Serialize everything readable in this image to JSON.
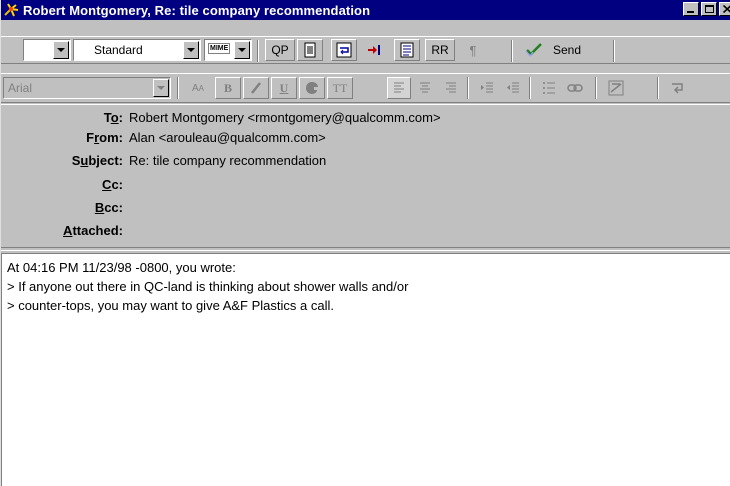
{
  "window": {
    "title": "Robert Montgomery, Re: tile company recommendation",
    "icon": "eudora-message-icon"
  },
  "toolbar1": {
    "priority_value": "",
    "format_value": "Standard",
    "mime_label": "MIME",
    "qp_label": "QP",
    "rr_label": "RR",
    "send_label": "Send",
    "icons": [
      "text-as-attachment-icon",
      "word-wrap-icon",
      "tabs-in-body-icon",
      "keep-copy-icon",
      "return-receipt-icon",
      "paragraph-icon",
      "send-icon"
    ]
  },
  "toolbar2": {
    "font_value": "Arial",
    "icons": [
      "font-size-icon",
      "bold-icon",
      "italic-icon",
      "underline-icon",
      "color-icon",
      "teletype-icon",
      "align-left-icon",
      "align-center-icon",
      "align-right-icon",
      "indent-icon",
      "outdent-icon",
      "bullet-list-icon",
      "link-icon",
      "clear-format-icon",
      "wrap-icon"
    ]
  },
  "headers": {
    "to": {
      "label_pre": "T",
      "label_u": "o",
      "label_post": ":",
      "value": "Robert Montgomery <rmontgomery@qualcomm.com>"
    },
    "from": {
      "label_pre": "F",
      "label_u": "r",
      "label_post": "om:",
      "value": "Alan <arouleau@qualcomm.com>"
    },
    "subject": {
      "label_pre": "S",
      "label_u": "u",
      "label_post": "bject:",
      "value": "Re: tile company recommendation"
    },
    "cc": {
      "label_pre": "",
      "label_u": "C",
      "label_post": "c:",
      "value": ""
    },
    "bcc": {
      "label_pre": "",
      "label_u": "B",
      "label_post": "cc:",
      "value": ""
    },
    "attached": {
      "label_pre": "",
      "label_u": "A",
      "label_post": "ttached:",
      "value": ""
    }
  },
  "body": {
    "lines": [
      "At 04:16 PM 11/23/98 -0800, you wrote:",
      "> If anyone out there in QC-land is thinking about shower walls and/or",
      "> counter-tops, you may want to give A&F Plastics a call."
    ]
  }
}
